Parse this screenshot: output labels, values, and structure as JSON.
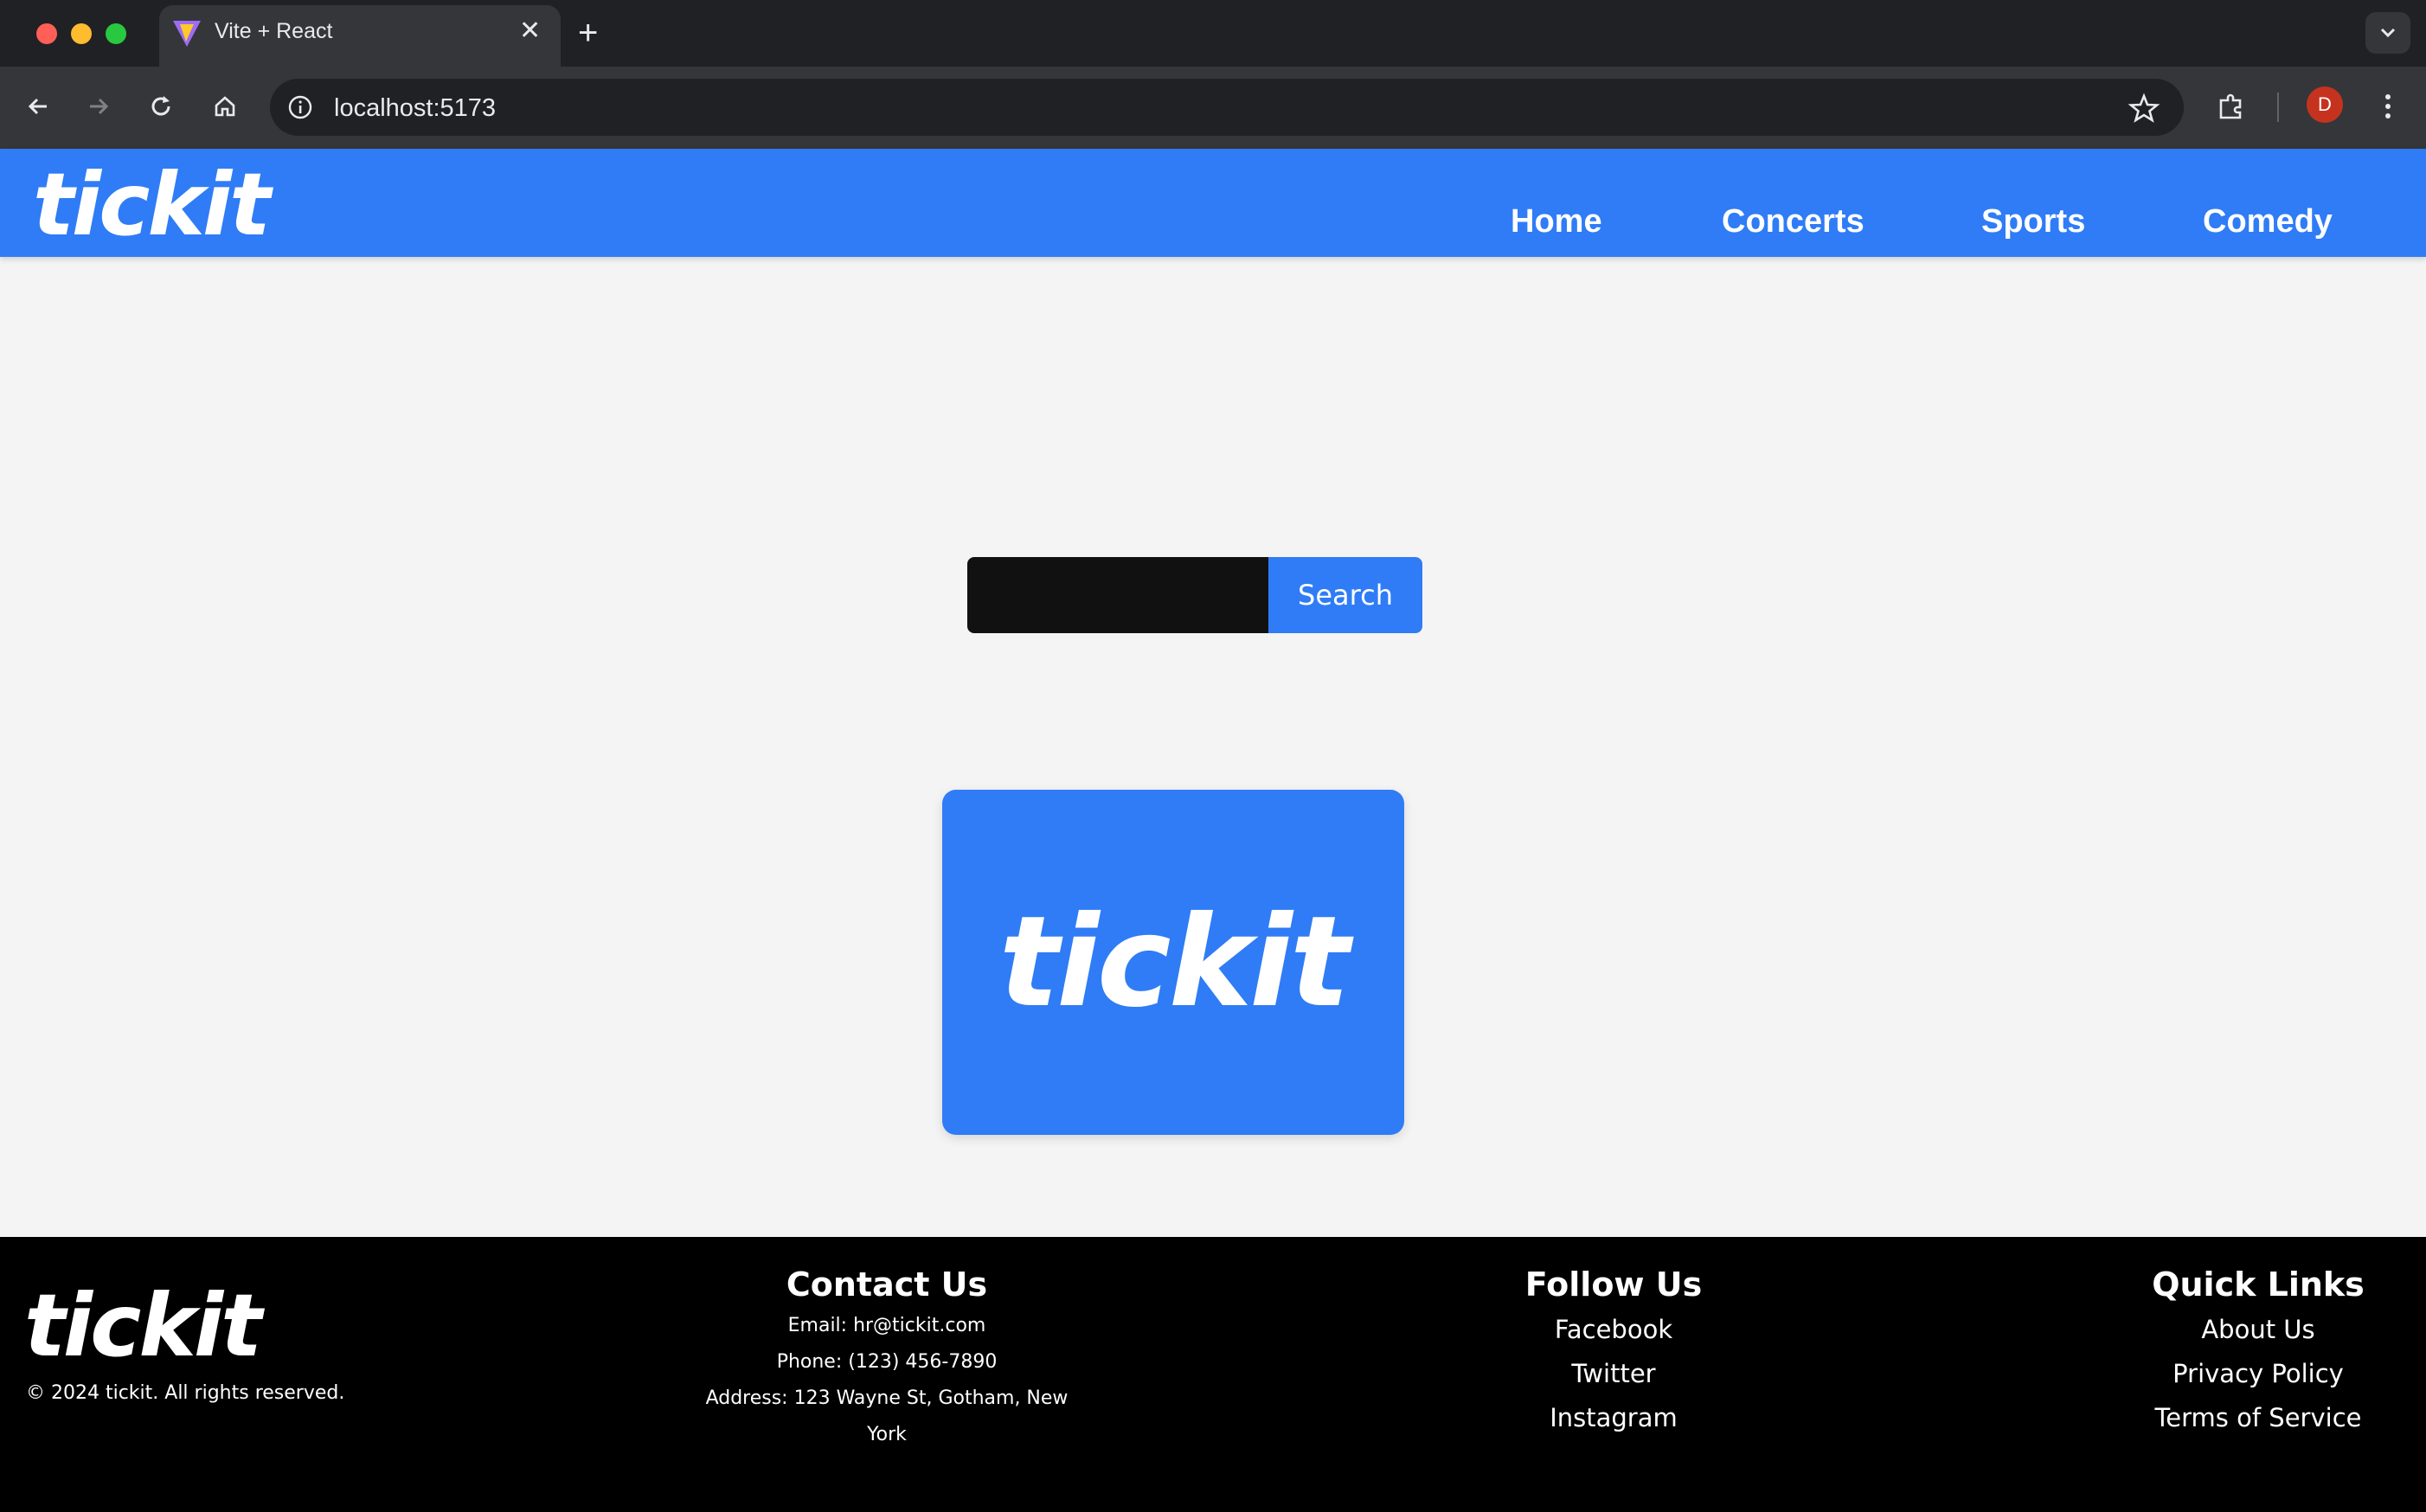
{
  "browser": {
    "tab_title": "Vite + React",
    "url": "localhost:5173",
    "profile_initial": "D"
  },
  "header": {
    "logo": "tickit",
    "nav": [
      "Home",
      "Concerts",
      "Sports",
      "Comedy"
    ]
  },
  "search": {
    "value": "",
    "placeholder": "",
    "button_label": "Search"
  },
  "hero": {
    "logo": "tickit"
  },
  "footer": {
    "logo": "tickit",
    "copyright": "© 2024 tickit. All rights reserved.",
    "contact": {
      "heading": "Contact Us",
      "email": "Email: hr@tickit.com",
      "phone": "Phone: (123) 456-7890",
      "address": "Address: 123 Wayne St, Gotham, New York"
    },
    "follow": {
      "heading": "Follow Us",
      "links": [
        "Facebook",
        "Twitter",
        "Instagram"
      ]
    },
    "quick_links": {
      "heading": "Quick Links",
      "links": [
        "About Us",
        "Privacy Policy",
        "Terms of Service"
      ]
    }
  },
  "colors": {
    "brand_blue": "#2f7cf6",
    "footer_bg": "#000000",
    "page_bg": "#f4f4f4"
  }
}
